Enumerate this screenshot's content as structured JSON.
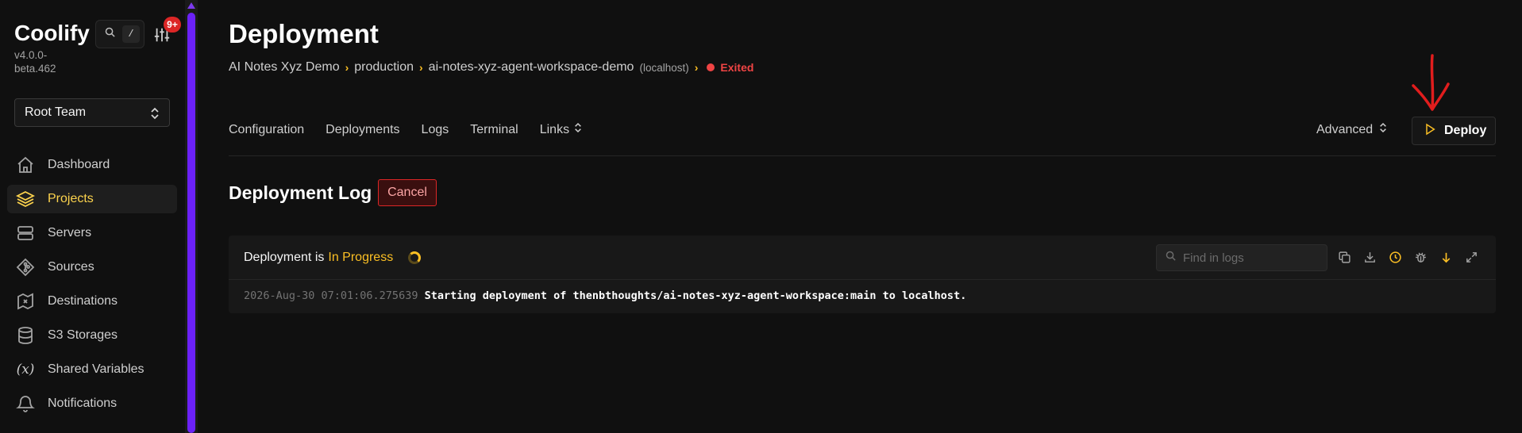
{
  "sidebar": {
    "brand": "Coolify",
    "version": "v4.0.0-beta.462",
    "search_key": "/",
    "notification_count": "9+",
    "team_select": "Root Team",
    "items": [
      {
        "label": "Dashboard",
        "icon": "home-icon"
      },
      {
        "label": "Projects",
        "icon": "layers-icon",
        "active": true
      },
      {
        "label": "Servers",
        "icon": "server-icon"
      },
      {
        "label": "Sources",
        "icon": "git-icon"
      },
      {
        "label": "Destinations",
        "icon": "map-icon"
      },
      {
        "label": "S3 Storages",
        "icon": "database-icon"
      },
      {
        "label": "Shared Variables",
        "icon": "variable-icon"
      },
      {
        "label": "Notifications",
        "icon": "bell-icon"
      }
    ]
  },
  "header": {
    "title": "Deployment",
    "breadcrumb": {
      "project": "AI Notes Xyz Demo",
      "environment": "production",
      "application": "ai-notes-xyz-agent-workspace-demo",
      "host": "(localhost)",
      "status": "Exited"
    }
  },
  "tabs": [
    "Configuration",
    "Deployments",
    "Logs",
    "Terminal",
    "Links"
  ],
  "actions": {
    "advanced_label": "Advanced",
    "deploy_label": "Deploy"
  },
  "deployment_log": {
    "heading": "Deployment Log",
    "cancel_label": "Cancel",
    "status_prefix": "Deployment is",
    "status_value": "In Progress",
    "search_placeholder": "Find in logs",
    "lines": [
      {
        "timestamp": "2026-Aug-30 07:01:06.275639",
        "message": "Starting deployment of thenbthoughts/ai-notes-xyz-agent-workspace:main to localhost."
      }
    ]
  },
  "colors": {
    "accent": "#fbbf24",
    "active_nav": "#fcd34d",
    "danger": "#ef4444",
    "scrollbar": "#6b21f7",
    "annotation": "#e11d1d"
  }
}
